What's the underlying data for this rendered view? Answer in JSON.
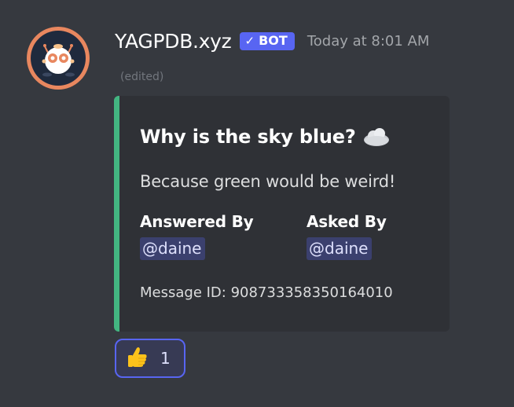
{
  "message": {
    "author": "YAGPDB.xyz",
    "bot_tag": "BOT",
    "timestamp": "Today at 8:01 AM",
    "edited": "(edited)",
    "avatar_icon": "robot-avatar-icon"
  },
  "embed": {
    "accent_color": "#43b581",
    "title": "Why is the sky blue?",
    "title_icon": "cloud-icon",
    "description": "Because green would be weird!",
    "fields": [
      {
        "name": "Answered By",
        "value": "@daine"
      },
      {
        "name": "Asked By",
        "value": "@daine"
      }
    ],
    "footer": "Message ID: 908733358350164010"
  },
  "reactions": [
    {
      "icon": "thumbs-up-icon",
      "count": "1"
    }
  ],
  "colors": {
    "background": "#36393f",
    "embed_background": "#2f3136",
    "bot_tag": "#5865f2",
    "mention_bg": "#414675"
  }
}
